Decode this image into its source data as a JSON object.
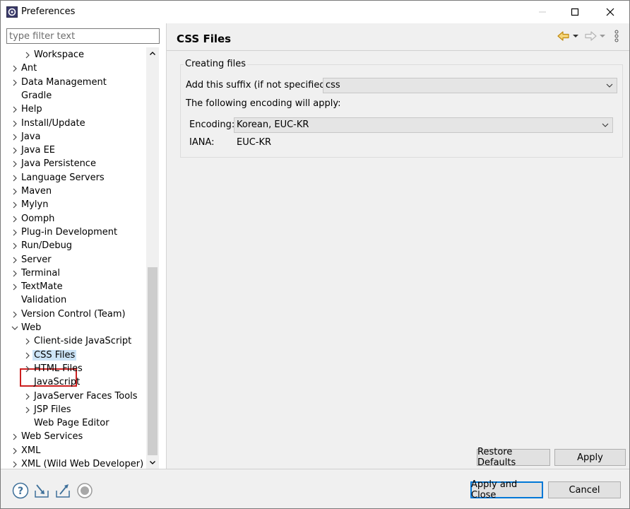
{
  "window": {
    "title": "Preferences"
  },
  "filter": {
    "placeholder": "type filter text",
    "value": ""
  },
  "tree": [
    {
      "label": "Workspace",
      "level": 1,
      "expandable": true,
      "expanded": false
    },
    {
      "label": "Ant",
      "level": 0,
      "expandable": true,
      "expanded": false
    },
    {
      "label": "Data Management",
      "level": 0,
      "expandable": true,
      "expanded": false
    },
    {
      "label": "Gradle",
      "level": 0,
      "expandable": false
    },
    {
      "label": "Help",
      "level": 0,
      "expandable": true,
      "expanded": false
    },
    {
      "label": "Install/Update",
      "level": 0,
      "expandable": true,
      "expanded": false
    },
    {
      "label": "Java",
      "level": 0,
      "expandable": true,
      "expanded": false
    },
    {
      "label": "Java EE",
      "level": 0,
      "expandable": true,
      "expanded": false
    },
    {
      "label": "Java Persistence",
      "level": 0,
      "expandable": true,
      "expanded": false
    },
    {
      "label": "Language Servers",
      "level": 0,
      "expandable": true,
      "expanded": false
    },
    {
      "label": "Maven",
      "level": 0,
      "expandable": true,
      "expanded": false
    },
    {
      "label": "Mylyn",
      "level": 0,
      "expandable": true,
      "expanded": false
    },
    {
      "label": "Oomph",
      "level": 0,
      "expandable": true,
      "expanded": false
    },
    {
      "label": "Plug-in Development",
      "level": 0,
      "expandable": true,
      "expanded": false
    },
    {
      "label": "Run/Debug",
      "level": 0,
      "expandable": true,
      "expanded": false
    },
    {
      "label": "Server",
      "level": 0,
      "expandable": true,
      "expanded": false
    },
    {
      "label": "Terminal",
      "level": 0,
      "expandable": true,
      "expanded": false
    },
    {
      "label": "TextMate",
      "level": 0,
      "expandable": true,
      "expanded": false
    },
    {
      "label": "Validation",
      "level": 0,
      "expandable": false
    },
    {
      "label": "Version Control (Team)",
      "level": 0,
      "expandable": true,
      "expanded": false
    },
    {
      "label": "Web",
      "level": 0,
      "expandable": true,
      "expanded": true
    },
    {
      "label": "Client-side JavaScript",
      "level": 1,
      "expandable": true,
      "expanded": false
    },
    {
      "label": "CSS Files",
      "level": 1,
      "expandable": true,
      "expanded": false,
      "selected": true
    },
    {
      "label": "HTML Files",
      "level": 1,
      "expandable": true,
      "expanded": false
    },
    {
      "label": "JavaScript",
      "level": 1,
      "expandable": false
    },
    {
      "label": "JavaServer Faces Tools",
      "level": 1,
      "expandable": true,
      "expanded": false
    },
    {
      "label": "JSP Files",
      "level": 1,
      "expandable": true,
      "expanded": false
    },
    {
      "label": "Web Page Editor",
      "level": 1,
      "expandable": false
    },
    {
      "label": "Web Services",
      "level": 0,
      "expandable": true,
      "expanded": false
    },
    {
      "label": "XML",
      "level": 0,
      "expandable": true,
      "expanded": false
    },
    {
      "label": "XML (Wild Web Developer)",
      "level": 0,
      "expandable": true,
      "expanded": false
    }
  ],
  "page": {
    "title": "CSS Files",
    "group_title": "Creating files",
    "suffix_label": "Add this suffix (if not specified):",
    "suffix_value": "css",
    "encoding_note": "The following encoding will apply:",
    "encoding_label": "Encoding:",
    "encoding_value": "Korean, EUC-KR",
    "iana_label": "IANA:",
    "iana_value": "EUC-KR"
  },
  "buttons": {
    "restore_defaults": "Restore Defaults",
    "apply": "Apply",
    "apply_and_close": "Apply and Close",
    "cancel": "Cancel"
  },
  "colors": {
    "selection": "#cce4f7",
    "highlight_box": "#cc1f1f",
    "default_button_border": "#0078d7",
    "back_arrow": "#e8a317"
  }
}
